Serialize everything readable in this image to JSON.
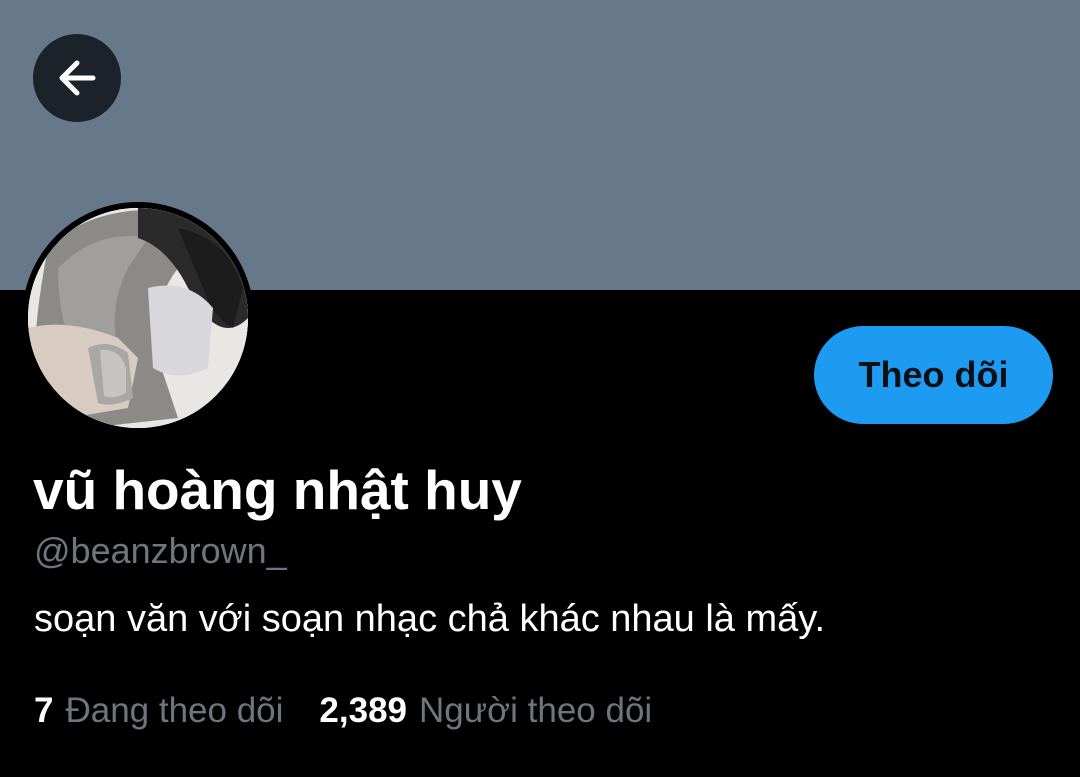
{
  "header": {
    "back_icon": "arrow-left-icon",
    "banner_color": "#66788a"
  },
  "profile": {
    "avatar": "profile-photo",
    "follow_label": "Theo dõi",
    "display_name": "vũ hoàng nhật huy",
    "handle": "@beanzbrown_",
    "bio": "soạn văn với soạn nhạc chả khác nhau là mấy.",
    "following_count": "7",
    "following_label": "Đang theo dõi",
    "followers_count": "2,389",
    "followers_label": "Người theo dõi"
  },
  "colors": {
    "accent": "#1d9bf0",
    "background": "#000000",
    "muted_text": "#6e767d"
  }
}
